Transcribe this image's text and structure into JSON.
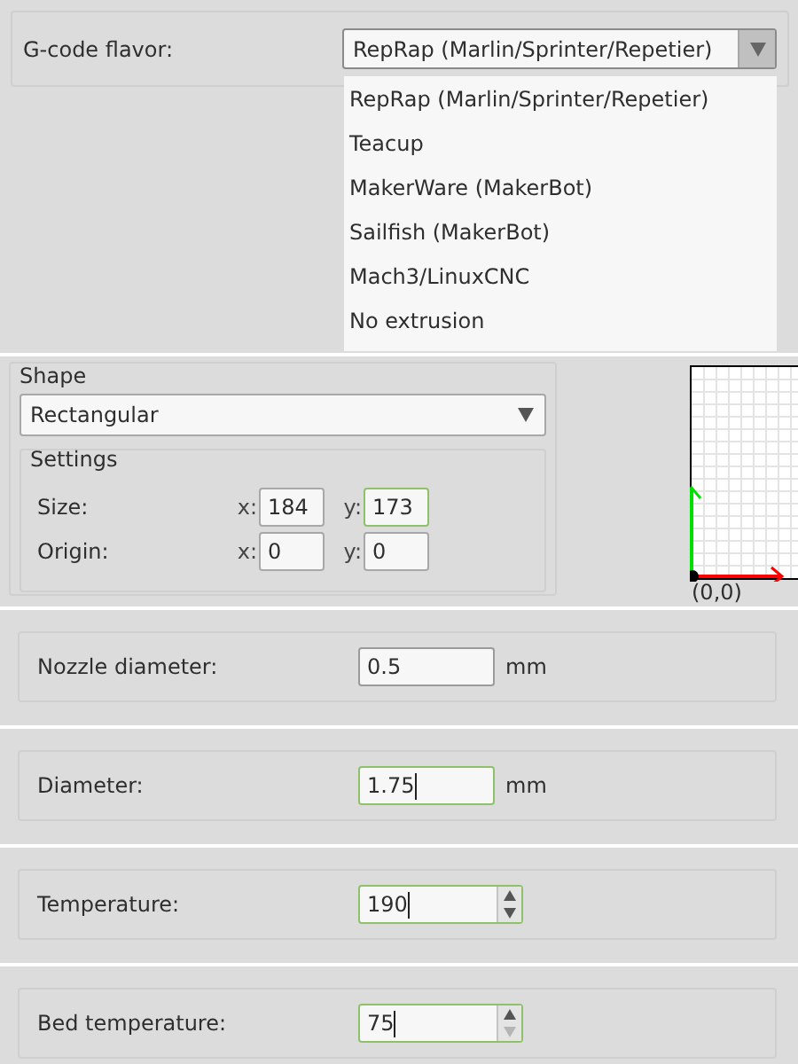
{
  "flavor": {
    "label": "G-code flavor:",
    "value": "RepRap (Marlin/Sprinter/Repetier)",
    "expanded": true,
    "options": [
      {
        "label": "RepRap (Marlin/Sprinter/Repetier)"
      },
      {
        "label": "Teacup"
      },
      {
        "label": "MakerWare (MakerBot)"
      },
      {
        "label": "Sailfish (MakerBot)"
      },
      {
        "label": "Mach3/LinuxCNC"
      },
      {
        "label": "No extrusion"
      }
    ]
  },
  "shape": {
    "title": "Shape",
    "value": "Rectangular",
    "settings_title": "Settings",
    "rows": [
      {
        "label": "Size:",
        "fields": [
          {
            "axis": "x:",
            "value": "184",
            "focused": false
          },
          {
            "axis": "y:",
            "value": "173",
            "focused": true
          }
        ]
      },
      {
        "label": "Origin:",
        "fields": [
          {
            "axis": "x:",
            "value": "0",
            "focused": false
          },
          {
            "axis": "y:",
            "value": "0",
            "focused": false
          }
        ]
      }
    ],
    "origin_label": "(0,0)"
  },
  "fields": [
    {
      "kind": "text",
      "label": "Nozzle diameter:",
      "value": "0.5",
      "unit": "mm",
      "focused": false,
      "caret": false
    },
    {
      "kind": "text",
      "label": "Diameter:",
      "value": "1.75",
      "unit": "mm",
      "focused": true,
      "caret": true
    },
    {
      "kind": "spin",
      "label": "Temperature:",
      "value": "190",
      "focused": true,
      "caret": true,
      "down_disabled": false
    },
    {
      "kind": "spin",
      "label": "Bed temperature:",
      "value": "75",
      "focused": true,
      "caret": true,
      "down_disabled": true
    }
  ]
}
